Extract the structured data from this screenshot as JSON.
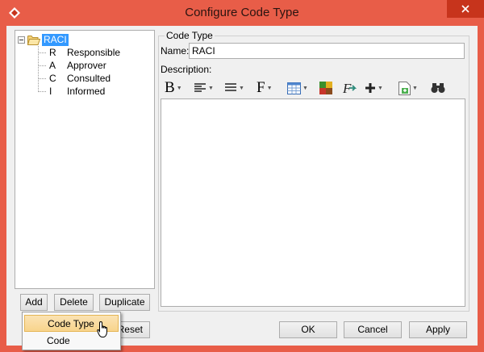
{
  "window": {
    "title": "Configure Code Type",
    "titlebar_color": "#e85d48",
    "app_icon": "visual-paradigm-icon",
    "close_icon": "close-x-icon"
  },
  "tree": {
    "root": {
      "label": "RACI",
      "icon": "folder-open-icon",
      "selected": true
    },
    "items": [
      {
        "code": "R",
        "name": "Responsible"
      },
      {
        "code": "A",
        "name": "Approver"
      },
      {
        "code": "C",
        "name": "Consulted"
      },
      {
        "code": "I",
        "name": "Informed"
      }
    ]
  },
  "tree_buttons": {
    "add": "Add",
    "delete": "Delete",
    "duplicate": "Duplicate",
    "reset": "Reset"
  },
  "popup_menu": {
    "items": [
      {
        "label": "Code Type",
        "highlighted": true
      },
      {
        "label": "Code",
        "highlighted": false
      }
    ]
  },
  "details": {
    "group_title": "Code Type",
    "name_label": "Name:",
    "name_value": "RACI",
    "description_label": "Description:",
    "description_value": ""
  },
  "toolbar": {
    "tools": [
      {
        "icon": "bold-icon",
        "glyph": "B",
        "dropdown": true
      },
      {
        "icon": "align-left-icon",
        "dropdown": true
      },
      {
        "icon": "list-icon",
        "dropdown": true
      },
      {
        "icon": "font-icon",
        "glyph": "F",
        "dropdown": true
      },
      {
        "icon": "table-icon",
        "dropdown": true
      },
      {
        "icon": "color-picker-icon",
        "dropdown": false
      },
      {
        "icon": "clear-format-icon",
        "dropdown": false
      },
      {
        "icon": "insert-plus-icon",
        "dropdown": true
      },
      {
        "icon": "insert-image-icon",
        "dropdown": true
      },
      {
        "icon": "find-binoculars-icon",
        "dropdown": false
      }
    ]
  },
  "dialog_buttons": {
    "ok": "OK",
    "cancel": "Cancel",
    "apply": "Apply"
  }
}
